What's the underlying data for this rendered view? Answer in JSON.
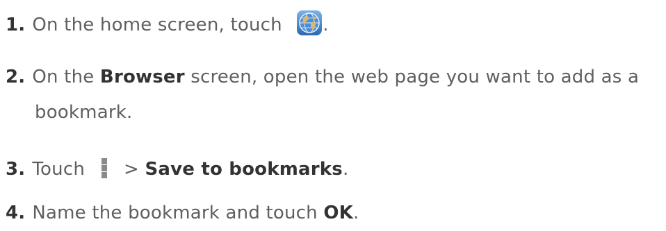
{
  "steps": [
    {
      "num": "1.",
      "text": "On the home screen, touch",
      "tail": "."
    },
    {
      "num": "2.",
      "pre": "On the ",
      "bold": "Browser",
      "post": " screen, open the web page you want to add as a",
      "line2": "bookmark."
    },
    {
      "num": "3.",
      "pre": "Touch",
      "mid": "> ",
      "bold": "Save to bookmarks",
      "post": "."
    },
    {
      "num": "4.",
      "pre": "Name the bookmark and touch ",
      "bold": "OK",
      "post": "."
    }
  ],
  "icons": {
    "browser": "globe-icon",
    "menu": "more-options-icon"
  }
}
